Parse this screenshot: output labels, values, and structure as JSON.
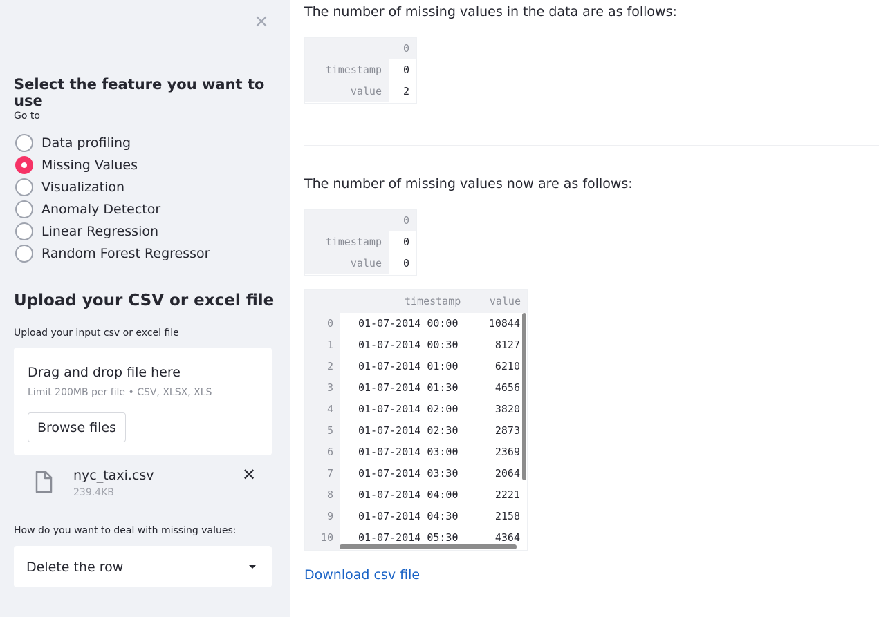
{
  "sidebar": {
    "close_icon": "close-icon",
    "feature_heading": "Select the feature you want to use",
    "goto_label": "Go to",
    "options": [
      {
        "label": "Data profiling",
        "selected": false
      },
      {
        "label": "Missing Values",
        "selected": true
      },
      {
        "label": "Visualization",
        "selected": false
      },
      {
        "label": "Anomaly Detector",
        "selected": false
      },
      {
        "label": "Linear Regression",
        "selected": false
      },
      {
        "label": "Random Forest Regressor",
        "selected": false
      }
    ],
    "accent_color": "#f63366",
    "upload_heading": "Upload your CSV or excel file",
    "upload_label": "Upload your input csv or excel file",
    "dropzone": {
      "title": "Drag and drop file here",
      "limit": "Limit 200MB per file • CSV, XLSX, XLS",
      "browse_label": "Browse files"
    },
    "file": {
      "icon": "file-icon",
      "name": "nyc_taxi.csv",
      "size": "239.4KB"
    },
    "missing_label": "How do you want to deal with missing values:",
    "missing_select": {
      "value": "Delete the row"
    }
  },
  "main": {
    "before_text": "The number of missing values in the data are as follows:",
    "before_table": {
      "header": "0",
      "rows": [
        {
          "name": "timestamp",
          "value": "0"
        },
        {
          "name": "value",
          "value": "2"
        }
      ]
    },
    "after_text": "The number of missing values now are as follows:",
    "after_table": {
      "header": "0",
      "rows": [
        {
          "name": "timestamp",
          "value": "0"
        },
        {
          "name": "value",
          "value": "0"
        }
      ]
    },
    "data_table": {
      "columns": [
        "timestamp",
        "value"
      ],
      "rows": [
        {
          "idx": "0",
          "timestamp": "01-07-2014 00:00",
          "value": "10844"
        },
        {
          "idx": "1",
          "timestamp": "01-07-2014 00:30",
          "value": "8127"
        },
        {
          "idx": "2",
          "timestamp": "01-07-2014 01:00",
          "value": "6210"
        },
        {
          "idx": "3",
          "timestamp": "01-07-2014 01:30",
          "value": "4656"
        },
        {
          "idx": "4",
          "timestamp": "01-07-2014 02:00",
          "value": "3820"
        },
        {
          "idx": "5",
          "timestamp": "01-07-2014 02:30",
          "value": "2873"
        },
        {
          "idx": "6",
          "timestamp": "01-07-2014 03:00",
          "value": "2369"
        },
        {
          "idx": "7",
          "timestamp": "01-07-2014 03:30",
          "value": "2064"
        },
        {
          "idx": "8",
          "timestamp": "01-07-2014 04:00",
          "value": "2221"
        },
        {
          "idx": "9",
          "timestamp": "01-07-2014 04:30",
          "value": "2158"
        },
        {
          "idx": "10",
          "timestamp": "01-07-2014 05:30",
          "value": "4364"
        }
      ]
    },
    "download_link": "Download csv file"
  }
}
